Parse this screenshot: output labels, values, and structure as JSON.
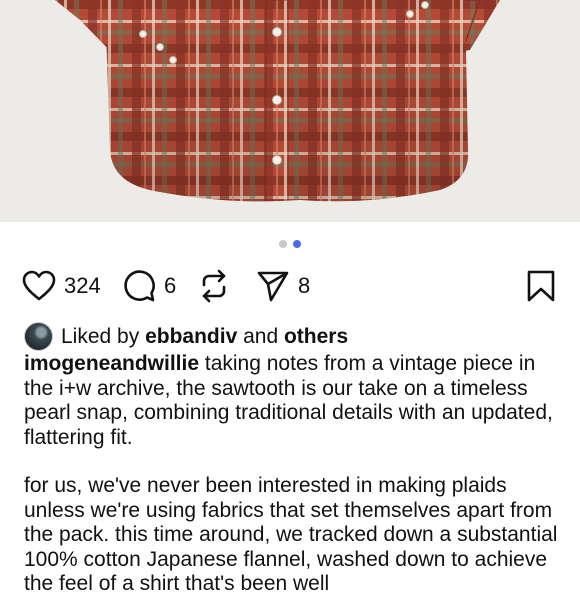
{
  "post": {
    "image_alt": "red plaid pearl snap shirt",
    "carousel": {
      "total": 2,
      "active": 2
    },
    "shirt_colors": {
      "base": "#b54a36",
      "dark": "#7e2e22",
      "light": "#e8d6c2",
      "green": "#6d7a5c"
    }
  },
  "actions": {
    "like_count": "324",
    "comment_count": "6",
    "share_count": "8"
  },
  "liked_by": {
    "prefix": "Liked by",
    "user": "ebbandiv",
    "and": "and",
    "others": "others"
  },
  "caption": {
    "username": "imogeneandwillie",
    "text1": " taking notes from a vintage piece in the i+w archive, the sawtooth is our take on a timeless pearl snap, combining traditional details with an updated, flattering fit.",
    "text2": "for us, we've never been interested in making plaids unless we're using fabrics that set themselves apart from the pack. this time around, we tracked down a substantial 100% cotton Japanese flannel, washed down to achieve the feel of a shirt that's been well"
  }
}
